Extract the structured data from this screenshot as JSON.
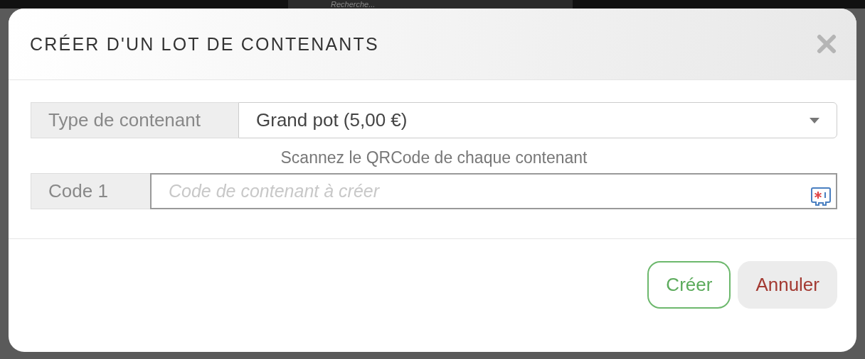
{
  "background": {
    "search": {
      "placeholder": "Recherche..."
    }
  },
  "dialog": {
    "title": "CRÉER D'UN LOT DE CONTENANTS",
    "fields": [
      {
        "kind": "select",
        "label": "Type de contenant",
        "value": "Grand pot (5,00 €)"
      },
      {
        "kind": "hint",
        "text": "Scannez le QRCode de chaque contenant"
      },
      {
        "kind": "input",
        "label": "Code 1",
        "placeholder": "Code de contenant à créer"
      }
    ],
    "buttons": [
      {
        "kind": "primary",
        "label": "Créer"
      },
      {
        "kind": "cancel",
        "label": "Annuler"
      }
    ]
  }
}
